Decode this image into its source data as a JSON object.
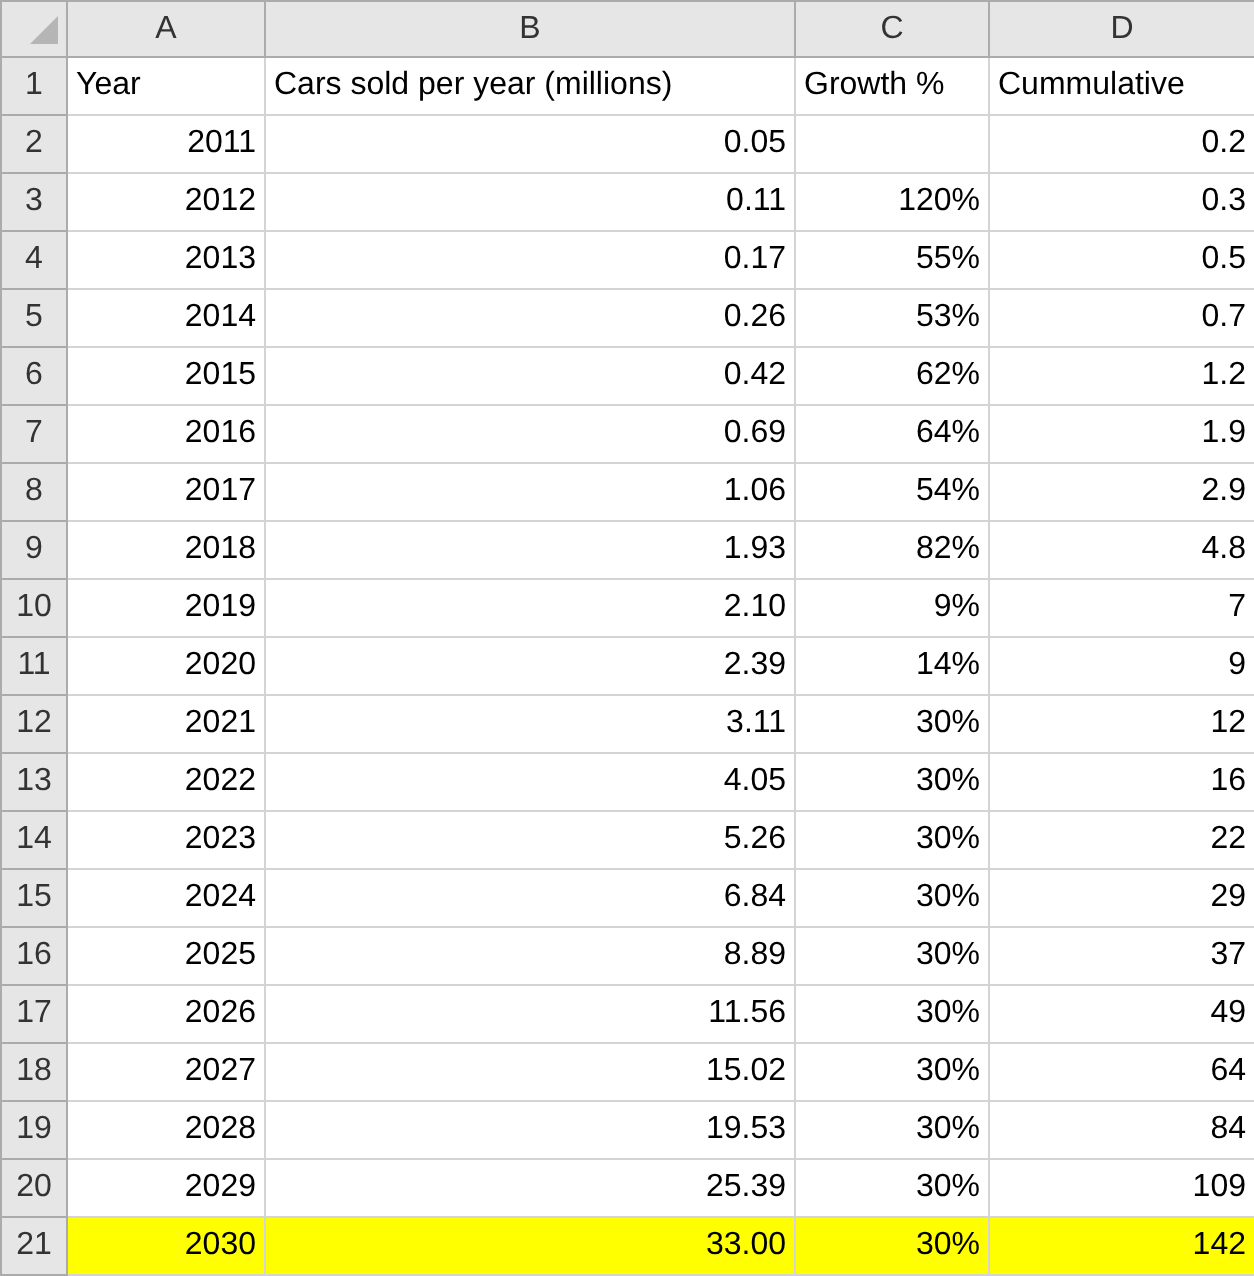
{
  "column_headers": [
    "A",
    "B",
    "C",
    "D"
  ],
  "rows": [
    {
      "number": "1",
      "kind": "text",
      "highlighted": false,
      "cells": [
        "Year",
        "Cars sold per year (millions)",
        "Growth %",
        "Cummulative"
      ]
    },
    {
      "number": "2",
      "kind": "number",
      "highlighted": false,
      "cells": [
        "2011",
        "0.05",
        null,
        "0.2"
      ]
    },
    {
      "number": "3",
      "kind": "number",
      "highlighted": false,
      "cells": [
        "2012",
        "0.11",
        "120%",
        "0.3"
      ]
    },
    {
      "number": "4",
      "kind": "number",
      "highlighted": false,
      "cells": [
        "2013",
        "0.17",
        "55%",
        "0.5"
      ]
    },
    {
      "number": "5",
      "kind": "number",
      "highlighted": false,
      "cells": [
        "2014",
        "0.26",
        "53%",
        "0.7"
      ]
    },
    {
      "number": "6",
      "kind": "number",
      "highlighted": false,
      "cells": [
        "2015",
        "0.42",
        "62%",
        "1.2"
      ]
    },
    {
      "number": "7",
      "kind": "number",
      "highlighted": false,
      "cells": [
        "2016",
        "0.69",
        "64%",
        "1.9"
      ]
    },
    {
      "number": "8",
      "kind": "number",
      "highlighted": false,
      "cells": [
        "2017",
        "1.06",
        "54%",
        "2.9"
      ]
    },
    {
      "number": "9",
      "kind": "number",
      "highlighted": false,
      "cells": [
        "2018",
        "1.93",
        "82%",
        "4.8"
      ]
    },
    {
      "number": "10",
      "kind": "number",
      "highlighted": false,
      "cells": [
        "2019",
        "2.10",
        "9%",
        "7"
      ]
    },
    {
      "number": "11",
      "kind": "number",
      "highlighted": false,
      "cells": [
        "2020",
        "2.39",
        "14%",
        "9"
      ]
    },
    {
      "number": "12",
      "kind": "number",
      "highlighted": false,
      "cells": [
        "2021",
        "3.11",
        "30%",
        "12"
      ]
    },
    {
      "number": "13",
      "kind": "number",
      "highlighted": false,
      "cells": [
        "2022",
        "4.05",
        "30%",
        "16"
      ]
    },
    {
      "number": "14",
      "kind": "number",
      "highlighted": false,
      "cells": [
        "2023",
        "5.26",
        "30%",
        "22"
      ]
    },
    {
      "number": "15",
      "kind": "number",
      "highlighted": false,
      "cells": [
        "2024",
        "6.84",
        "30%",
        "29"
      ]
    },
    {
      "number": "16",
      "kind": "number",
      "highlighted": false,
      "cells": [
        "2025",
        "8.89",
        "30%",
        "37"
      ]
    },
    {
      "number": "17",
      "kind": "number",
      "highlighted": false,
      "cells": [
        "2026",
        "11.56",
        "30%",
        "49"
      ]
    },
    {
      "number": "18",
      "kind": "number",
      "highlighted": false,
      "cells": [
        "2027",
        "15.02",
        "30%",
        "64"
      ]
    },
    {
      "number": "19",
      "kind": "number",
      "highlighted": false,
      "cells": [
        "2028",
        "19.53",
        "30%",
        "84"
      ]
    },
    {
      "number": "20",
      "kind": "number",
      "highlighted": false,
      "cells": [
        "2029",
        "25.39",
        "30%",
        "109"
      ]
    },
    {
      "number": "21",
      "kind": "number",
      "highlighted": true,
      "cells": [
        "2030",
        "33.00",
        "30%",
        "142"
      ]
    }
  ]
}
